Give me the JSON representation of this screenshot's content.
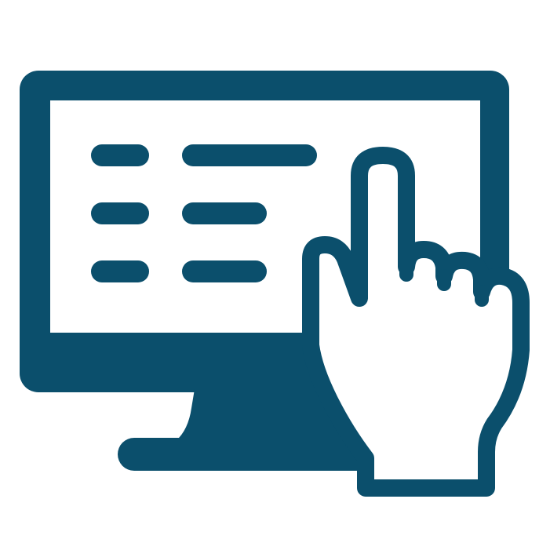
{
  "icon": {
    "name": "touch-screen-monitor-icon",
    "color": "#0b4f6c",
    "background": "#ffffff",
    "parts": [
      "monitor-icon",
      "list-lines-icon",
      "pointing-hand-icon"
    ]
  }
}
